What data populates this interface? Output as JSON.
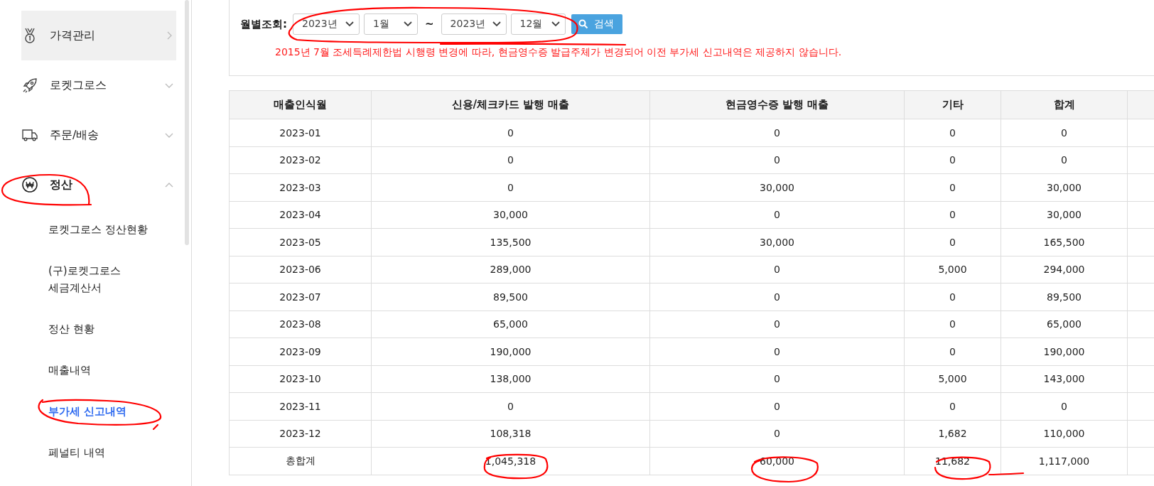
{
  "sidebar": {
    "items": [
      {
        "label": "가격관리",
        "kind": "link",
        "selected": false,
        "hovered": true
      },
      {
        "label": "로켓그로스",
        "kind": "group",
        "selected": false,
        "expanded": false,
        "hovered": false
      },
      {
        "label": "주문/배송",
        "kind": "group",
        "selected": false,
        "expanded": false,
        "hovered": false
      },
      {
        "label": "정산",
        "kind": "group",
        "selected": true,
        "expanded": true,
        "hovered": false,
        "children": [
          {
            "label": "로켓그로스 정산현황",
            "selected": false
          },
          {
            "label": "(구)로켓그로스\n세금계산서",
            "selected": false
          },
          {
            "label": "정산 현황",
            "selected": false
          },
          {
            "label": "매출내역",
            "selected": false
          },
          {
            "label": "부가세 신고내역",
            "selected": true
          },
          {
            "label": "페널티 내역",
            "selected": false
          }
        ]
      }
    ]
  },
  "filter": {
    "label": "월별조회:",
    "from_year": "2023년",
    "from_month": "1월",
    "separator": "~",
    "to_year": "2023년",
    "to_month": "12월",
    "search_button": "검색",
    "notice": "2015년 7월 조세특례제한법 시행령 변경에 따라, 현금영수증 발급주체가 변경되어 이전 부가세 신고내역은 제공하지 않습니다."
  },
  "table": {
    "columns": [
      "매출인식월",
      "신용/체크카드 발행 매출",
      "현금영수증 발행 매출",
      "기타",
      "합계"
    ],
    "rows": [
      [
        "2023-01",
        "0",
        "0",
        "0",
        "0"
      ],
      [
        "2023-02",
        "0",
        "0",
        "0",
        "0"
      ],
      [
        "2023-03",
        "0",
        "30,000",
        "0",
        "30,000"
      ],
      [
        "2023-04",
        "30,000",
        "0",
        "0",
        "30,000"
      ],
      [
        "2023-05",
        "135,500",
        "30,000",
        "0",
        "165,500"
      ],
      [
        "2023-06",
        "289,000",
        "0",
        "5,000",
        "294,000"
      ],
      [
        "2023-07",
        "89,500",
        "0",
        "0",
        "89,500"
      ],
      [
        "2023-08",
        "65,000",
        "0",
        "0",
        "65,000"
      ],
      [
        "2023-09",
        "190,000",
        "0",
        "0",
        "190,000"
      ],
      [
        "2023-10",
        "138,000",
        "0",
        "5,000",
        "143,000"
      ],
      [
        "2023-11",
        "0",
        "0",
        "0",
        "0"
      ],
      [
        "2023-12",
        "108,318",
        "0",
        "1,682",
        "110,000"
      ],
      [
        "총합계",
        "1,045,318",
        "60,000",
        "11,682",
        "1,117,000"
      ]
    ]
  }
}
